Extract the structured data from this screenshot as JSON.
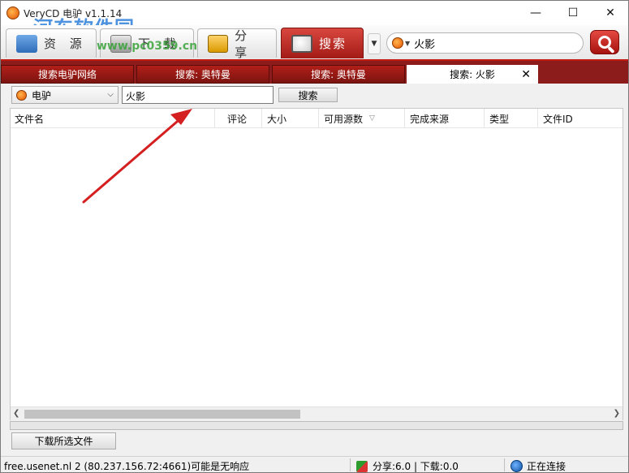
{
  "window": {
    "title": "VeryCD 电驴 v1.1.14",
    "watermark": "河东软件园",
    "watermark_url": "www.pc0359.cn"
  },
  "toolbar": {
    "nav": [
      {
        "label": "资 源",
        "icon": "globe-icon"
      },
      {
        "label": "下 载",
        "icon": "download-icon"
      },
      {
        "label": "分 享",
        "icon": "share-folder-icon"
      },
      {
        "label": "搜索",
        "icon": "search-magnifier-icon"
      }
    ],
    "search_value": "火影"
  },
  "tabs": [
    {
      "label": "搜索电驴网络"
    },
    {
      "label": "搜索: 奥特曼"
    },
    {
      "label": "搜索: 奥特曼"
    },
    {
      "label": "搜索: 火影",
      "active": true
    }
  ],
  "search_row": {
    "network": "电驴",
    "keyword": "火影",
    "search_button": "搜索"
  },
  "list": {
    "columns": [
      "文件名",
      "评论",
      "大小",
      "可用源数",
      "完成来源",
      "类型",
      "文件ID"
    ],
    "sorted_column": "可用源数",
    "rows": []
  },
  "download_button": "下载所选文件",
  "status": {
    "server": "free.usenet.nl 2 (80.237.156.72:4661)可能是无响应",
    "transfer": "分享:6.0 | 下载:0.0",
    "connection": "正在连接"
  },
  "colors": {
    "accent_red": "#a31b16",
    "tab_bar": "#8c1c1c",
    "annotation_arrow": "#d42020"
  }
}
